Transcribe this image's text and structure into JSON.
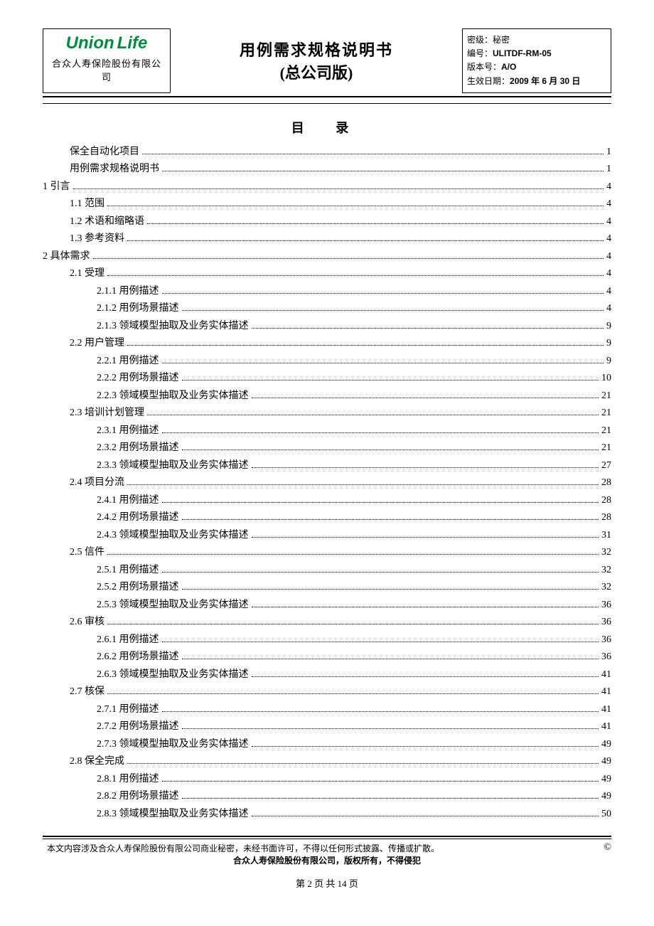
{
  "header": {
    "logo_main": "Union",
    "logo_sub": "Life",
    "company": "合众人寿保险股份有限公司",
    "title": "用例需求规格说明书",
    "subtitle": "(总公司版)",
    "meta": {
      "secrecy_label": "密级：",
      "secrecy_value": "秘密",
      "code_label": "编号：",
      "code_value": "ULITDF-RM-05",
      "version_label": "版本号：",
      "version_value": "A/O",
      "date_label": "生效日期：",
      "date_value": "2009 年 6 月 30 日"
    }
  },
  "toc_title": "目 录",
  "toc": [
    {
      "indent": 1,
      "label": "保全自动化项目",
      "page": "1"
    },
    {
      "indent": 1,
      "label": "用例需求规格说明书",
      "page": "1"
    },
    {
      "indent": 0,
      "label": "1 引言",
      "page": "4"
    },
    {
      "indent": 1,
      "label": "1.1 范围",
      "page": "4"
    },
    {
      "indent": 1,
      "label": "1.2 术语和缩略语",
      "page": "4"
    },
    {
      "indent": 1,
      "label": "1.3 参考资料",
      "page": "4"
    },
    {
      "indent": 0,
      "label": "2 具体需求",
      "page": "4"
    },
    {
      "indent": 1,
      "label": "2.1 受理",
      "page": "4"
    },
    {
      "indent": 2,
      "label": "2.1.1 用例描述",
      "page": "4"
    },
    {
      "indent": 2,
      "label": "2.1.2 用例场景描述",
      "page": "4"
    },
    {
      "indent": 2,
      "label": "2.1.3 领域模型抽取及业务实体描述",
      "page": "9"
    },
    {
      "indent": 1,
      "label": "2.2 用户管理",
      "page": "9"
    },
    {
      "indent": 2,
      "label": "2.2.1 用例描述",
      "page": "9"
    },
    {
      "indent": 2,
      "label": "2.2.2 用例场景描述",
      "page": "10"
    },
    {
      "indent": 2,
      "label": "2.2.3 领域模型抽取及业务实体描述",
      "page": "21"
    },
    {
      "indent": 1,
      "label": "2.3 培训计划管理",
      "page": "21"
    },
    {
      "indent": 2,
      "label": "2.3.1 用例描述",
      "page": "21"
    },
    {
      "indent": 2,
      "label": "2.3.2 用例场景描述",
      "page": "21"
    },
    {
      "indent": 2,
      "label": "2.3.3 领域模型抽取及业务实体描述",
      "page": "27"
    },
    {
      "indent": 1,
      "label": "2.4 项目分流",
      "page": "28"
    },
    {
      "indent": 2,
      "label": "2.4.1 用例描述",
      "page": "28"
    },
    {
      "indent": 2,
      "label": "2.4.2 用例场景描述",
      "page": "28"
    },
    {
      "indent": 2,
      "label": "2.4.3 领域模型抽取及业务实体描述",
      "page": "31"
    },
    {
      "indent": 1,
      "label": "2.5 信件",
      "page": "32"
    },
    {
      "indent": 2,
      "label": "2.5.1 用例描述",
      "page": "32"
    },
    {
      "indent": 2,
      "label": "2.5.2 用例场景描述",
      "page": "32"
    },
    {
      "indent": 2,
      "label": "2.5.3 领域模型抽取及业务实体描述",
      "page": "36"
    },
    {
      "indent": 1,
      "label": "2.6 审核",
      "page": "36"
    },
    {
      "indent": 2,
      "label": "2.6.1 用例描述",
      "page": "36"
    },
    {
      "indent": 2,
      "label": "2.6.2 用例场景描述",
      "page": "36"
    },
    {
      "indent": 2,
      "label": "2.6.3 领域模型抽取及业务实体描述",
      "page": "41"
    },
    {
      "indent": 1,
      "label": "2.7 核保",
      "page": "41"
    },
    {
      "indent": 2,
      "label": "2.7.1 用例描述",
      "page": "41"
    },
    {
      "indent": 2,
      "label": "2.7.2 用例场景描述",
      "page": "41"
    },
    {
      "indent": 2,
      "label": "2.7.3 领域模型抽取及业务实体描述",
      "page": "49"
    },
    {
      "indent": 1,
      "label": "2.8 保全完成",
      "page": "49"
    },
    {
      "indent": 2,
      "label": "2.8.1 用例描述",
      "page": "49"
    },
    {
      "indent": 2,
      "label": "2.8.2 用例场景描述",
      "page": "49"
    },
    {
      "indent": 2,
      "label": "2.8.3 领域模型抽取及业务实体描述",
      "page": "50"
    }
  ],
  "footer": {
    "line1": "本文内容涉及合众人寿保险股份有限公司商业秘密，未经书面许可，不得以任何形式披露、传播或扩散。",
    "line2": "合众人寿保险股份有限公司，版权所有，不得侵犯",
    "copyright": "©",
    "page_label": "第 2 页   共 14 页"
  }
}
